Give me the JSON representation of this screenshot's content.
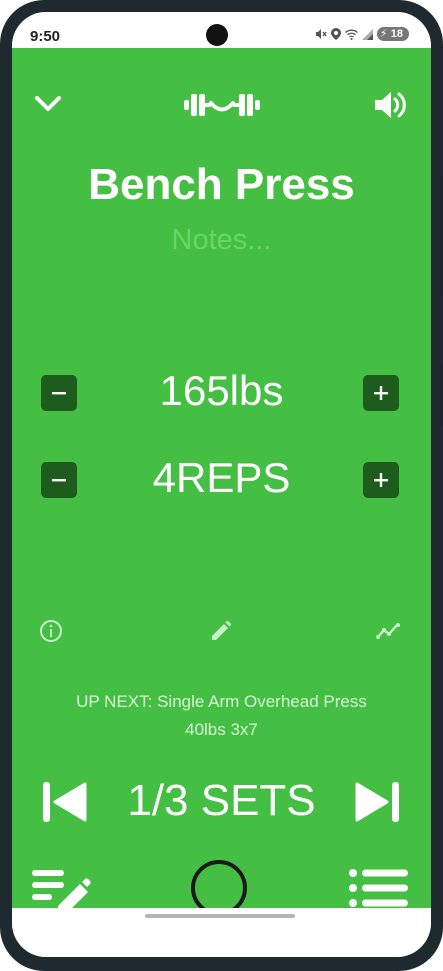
{
  "status_bar": {
    "time": "9:50",
    "battery": "18",
    "icons": [
      "mute-icon",
      "location-icon",
      "wifi-icon",
      "signal-icon",
      "battery-charging-icon"
    ]
  },
  "toolbar": {
    "collapse_icon": "chevron-down-icon",
    "logo_icon": "dumbbell-logo-icon",
    "sound_icon": "volume-icon"
  },
  "exercise": {
    "name": "Bench Press",
    "notes_placeholder": "Notes..."
  },
  "weight": {
    "value": "165lbs"
  },
  "reps": {
    "value": "4REPS"
  },
  "tools": {
    "info_icon": "info-icon",
    "edit_icon": "pencil-icon",
    "chart_icon": "trend-chart-icon"
  },
  "up_next": {
    "line1": "UP NEXT: Single Arm Overhead Press",
    "line2": "40lbs 3x7"
  },
  "sets": {
    "label": "1/3 SETS"
  },
  "bottom": {
    "edit_workout_icon": "edit-list-icon",
    "record_icon": "record-circle-icon",
    "workout_list_icon": "list-icon"
  },
  "colors": {
    "background": "#44bf44",
    "stepper_button": "#1d5c1d",
    "text": "#ffffff",
    "notes_placeholder": "#6ad46a",
    "up_next_text": "#d7f2d7"
  }
}
